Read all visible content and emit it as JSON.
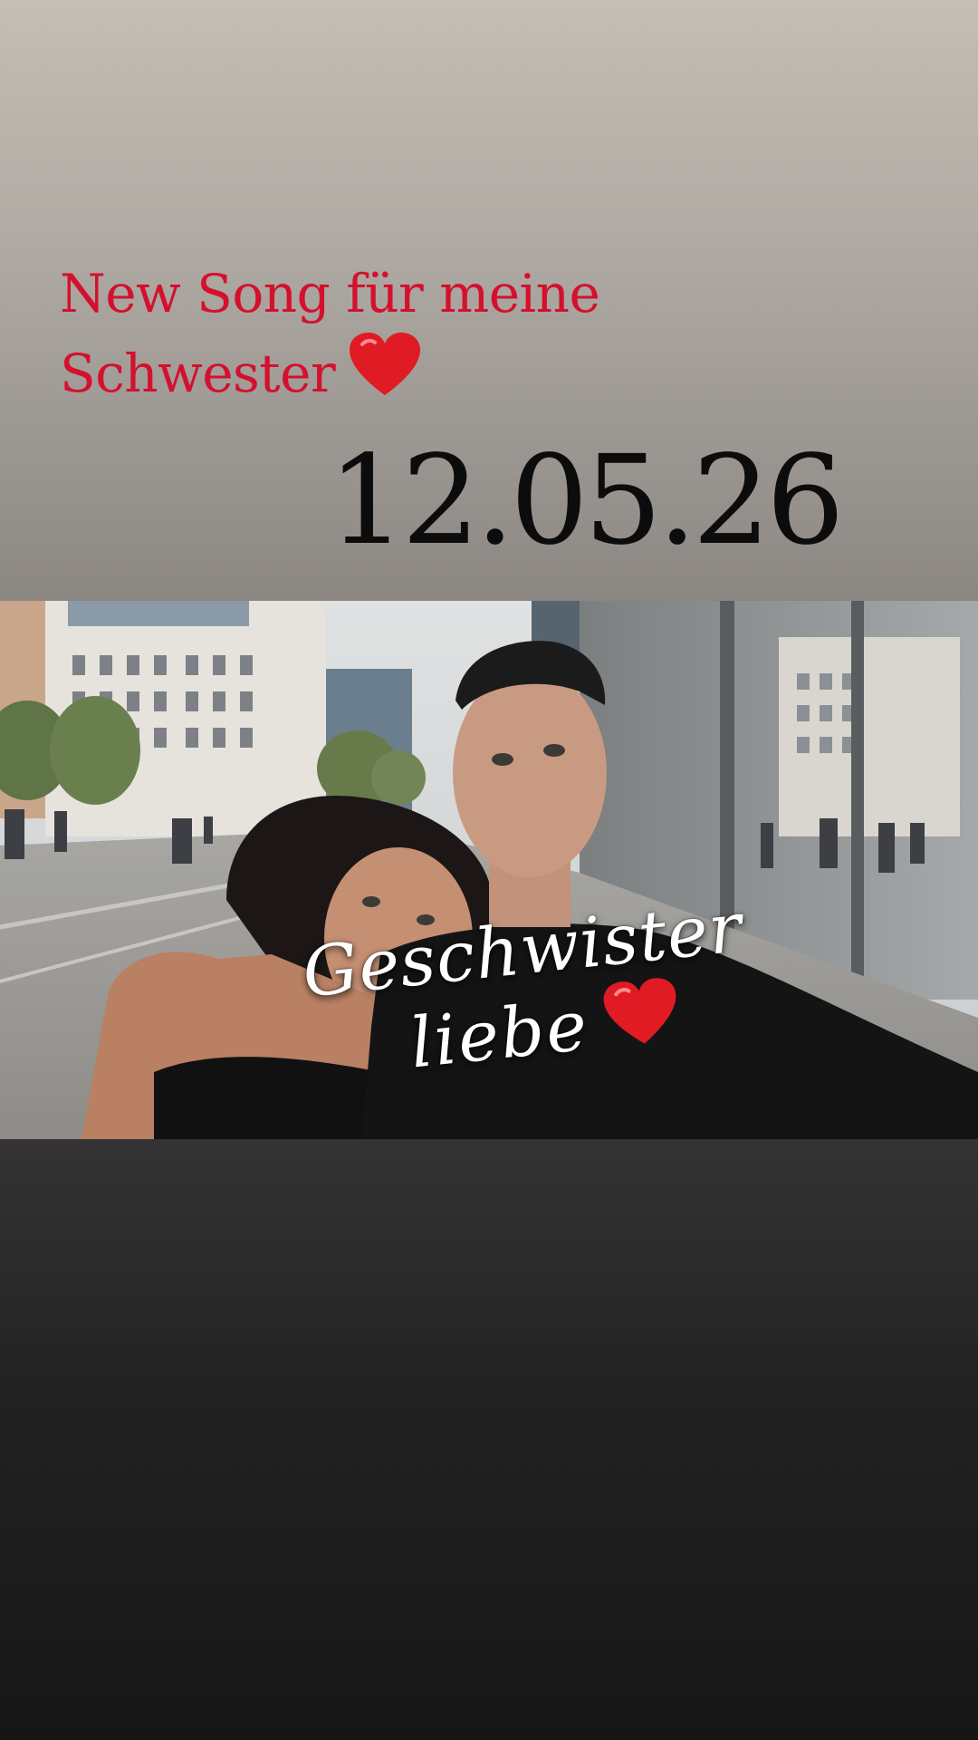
{
  "story": {
    "caption_line1": "New Song für meine",
    "caption_line2": "Schwester",
    "caption_heart_icon": "red-heart-icon",
    "release_date": "12.05.26",
    "photo": {
      "overlay_line1": "Geschwister",
      "overlay_line2": "liebe",
      "overlay_heart_icon": "red-heart-icon"
    }
  },
  "colors": {
    "caption": "#d4102e",
    "date": "#0c0c0c",
    "heart": "#e01b24",
    "overlay_text": "#ffffff"
  }
}
